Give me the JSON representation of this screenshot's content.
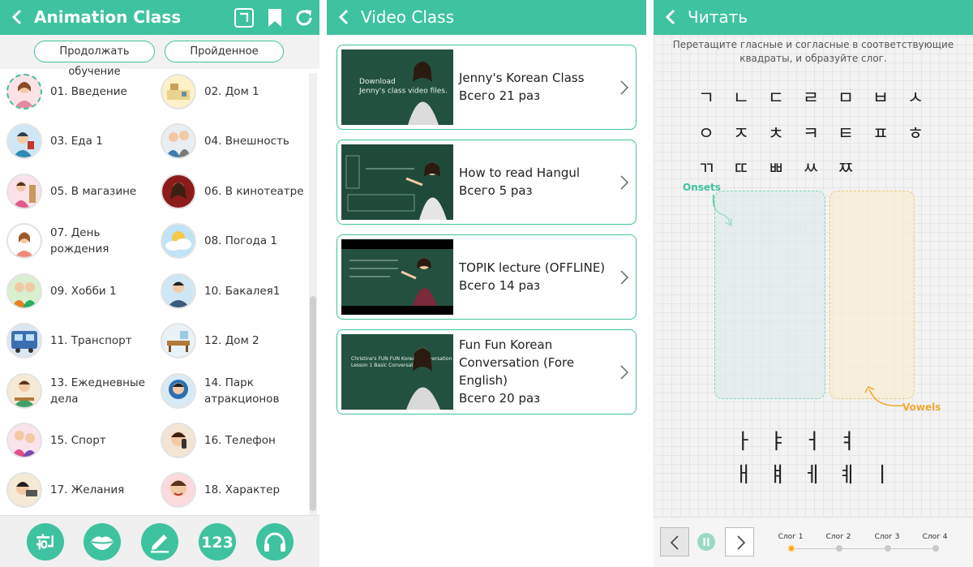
{
  "colors": {
    "accent": "#3fc2a0",
    "onsets": "#3fc2a0",
    "vowels": "#f0a830",
    "active_step": "#f5a623"
  },
  "animation_class": {
    "title": "Animation Class",
    "tabs": [
      "Продолжать обучение",
      "Пройденное"
    ],
    "lessons": [
      "01. Введение",
      "02. Дом 1",
      "03. Еда 1",
      "04. Внешность",
      "05. В магазине",
      "06. В кинотеатре",
      "07. День рождения",
      "08. Погода 1",
      "09. Хобби 1",
      "10. Бакалея1",
      "11. Транспорт",
      "12. Дом 2",
      "13. Ежедневные дела",
      "14. Парк атракционов",
      "15. Спорт",
      "16. Телефон",
      "17. Желания",
      "18. Характер"
    ],
    "icons": [
      "back-icon",
      "hangul-icon",
      "bookmark-icon",
      "refresh-icon"
    ],
    "bottom_nav": [
      {
        "name": "hangul-nav",
        "glyph": "한"
      },
      {
        "name": "lips-nav",
        "glyph": ""
      },
      {
        "name": "pencil-nav",
        "glyph": ""
      },
      {
        "name": "numbers-nav",
        "glyph": "123"
      },
      {
        "name": "headphones-nav",
        "glyph": ""
      }
    ]
  },
  "video_class": {
    "title": "Video Class",
    "videos": [
      {
        "title": "Jenny's Korean Class",
        "count": "Всего 21 раз",
        "thumb_text": "Download\nJenny's class video files."
      },
      {
        "title": "How to read Hangul",
        "count": "Всего 5 раз",
        "thumb_text": ""
      },
      {
        "title": "TOPIK lecture  (OFFLINE)",
        "count": "Всего 14 раз",
        "thumb_text": ""
      },
      {
        "title": "Fun Fun Korean Conversation (Fore English)",
        "count": "Всего 20 раз",
        "thumb_text": "Christine's FUN FUN Korean Conversation\nLesson 1 Basic Conversation"
      }
    ]
  },
  "read": {
    "title": "Читать",
    "instruction": "Перетащите гласные и согласные в соответствующие квадраты, и образуйте слог.",
    "consonants_row1": [
      "ㄱ",
      "ㄴ",
      "ㄷ",
      "ㄹ",
      "ㅁ",
      "ㅂ",
      "ㅅ"
    ],
    "consonants_row2": [
      "ㅇ",
      "ㅈ",
      "ㅊ",
      "ㅋ",
      "ㅌ",
      "ㅍ",
      "ㅎ"
    ],
    "consonants_row3": [
      "ㄲ",
      "ㄸ",
      "ㅃ",
      "ㅆ",
      "ㅉ"
    ],
    "onsets_label": "Onsets",
    "vowels_label": "Vowels",
    "vowels_row1": [
      "ㅏ",
      "ㅑ",
      "ㅓ",
      "ㅕ"
    ],
    "vowels_row2": [
      "ㅐ",
      "ㅒ",
      "ㅔ",
      "ㅖ",
      "ㅣ"
    ],
    "steps": [
      "Слог 1",
      "Слог 2",
      "Слог 3",
      "Слог 4"
    ],
    "active_step": 0
  }
}
